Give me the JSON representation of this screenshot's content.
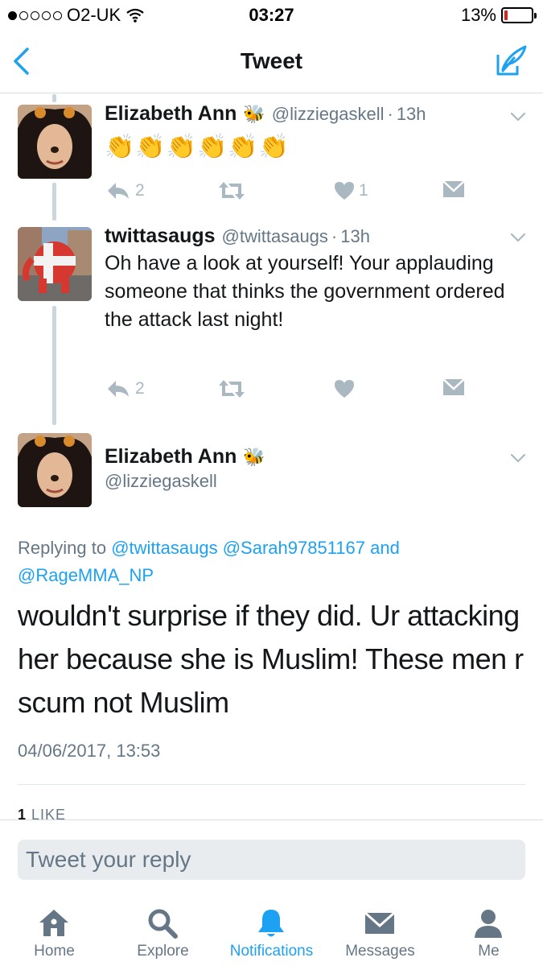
{
  "status_bar": {
    "carrier": "O2-UK",
    "time": "03:27",
    "battery": "13%",
    "battery_level": 0.13,
    "signal_bars_filled": 1,
    "signal_bars_total": 5
  },
  "nav": {
    "title": "Tweet",
    "back_icon": "chevron-left-icon",
    "compose_icon": "compose-tweet-icon"
  },
  "tweets": [
    {
      "name": "Elizabeth Ann",
      "handle": "@lizziegaskell",
      "time": "13h",
      "text": "👏👏👏👏👏👏",
      "reply_count": "2",
      "retweet_count": "",
      "like_count": "1"
    },
    {
      "name": "twittasaugs",
      "handle": "@twittasaugs",
      "time": "13h",
      "text": "Oh have a look at yourself! Your applauding someone that thinks the government ordered the attack last night!",
      "reply_count": "2",
      "retweet_count": "",
      "like_count": ""
    }
  ],
  "focused_tweet": {
    "name": "Elizabeth Ann",
    "handle": "@lizziegaskell",
    "replying_prefix": "Replying to",
    "mention_1": "@twittasaugs",
    "mention_2": "@Sarah97851167",
    "and_word": "and",
    "mention_3": "@RageMMA_NP",
    "text": "wouldn't surprise if they did. Ur attacking her because she is Muslim! These men r scum not Muslim",
    "date": "04/06/2017, 13:53",
    "likes_number": "1",
    "likes_label": "LIKE"
  },
  "reply": {
    "placeholder": "Tweet your reply"
  },
  "tabs": [
    {
      "label": "Home",
      "icon": "home-icon",
      "active": false
    },
    {
      "label": "Explore",
      "icon": "search-icon",
      "active": false
    },
    {
      "label": "Notifications",
      "icon": "bell-icon",
      "active": true
    },
    {
      "label": "Messages",
      "icon": "envelope-icon",
      "active": false
    },
    {
      "label": "Me",
      "icon": "person-icon",
      "active": false
    }
  ],
  "colors": {
    "accent": "#1da1f2",
    "muted": "#657786",
    "action_gray": "#aab8c2",
    "battery_low": "#e0211b"
  }
}
